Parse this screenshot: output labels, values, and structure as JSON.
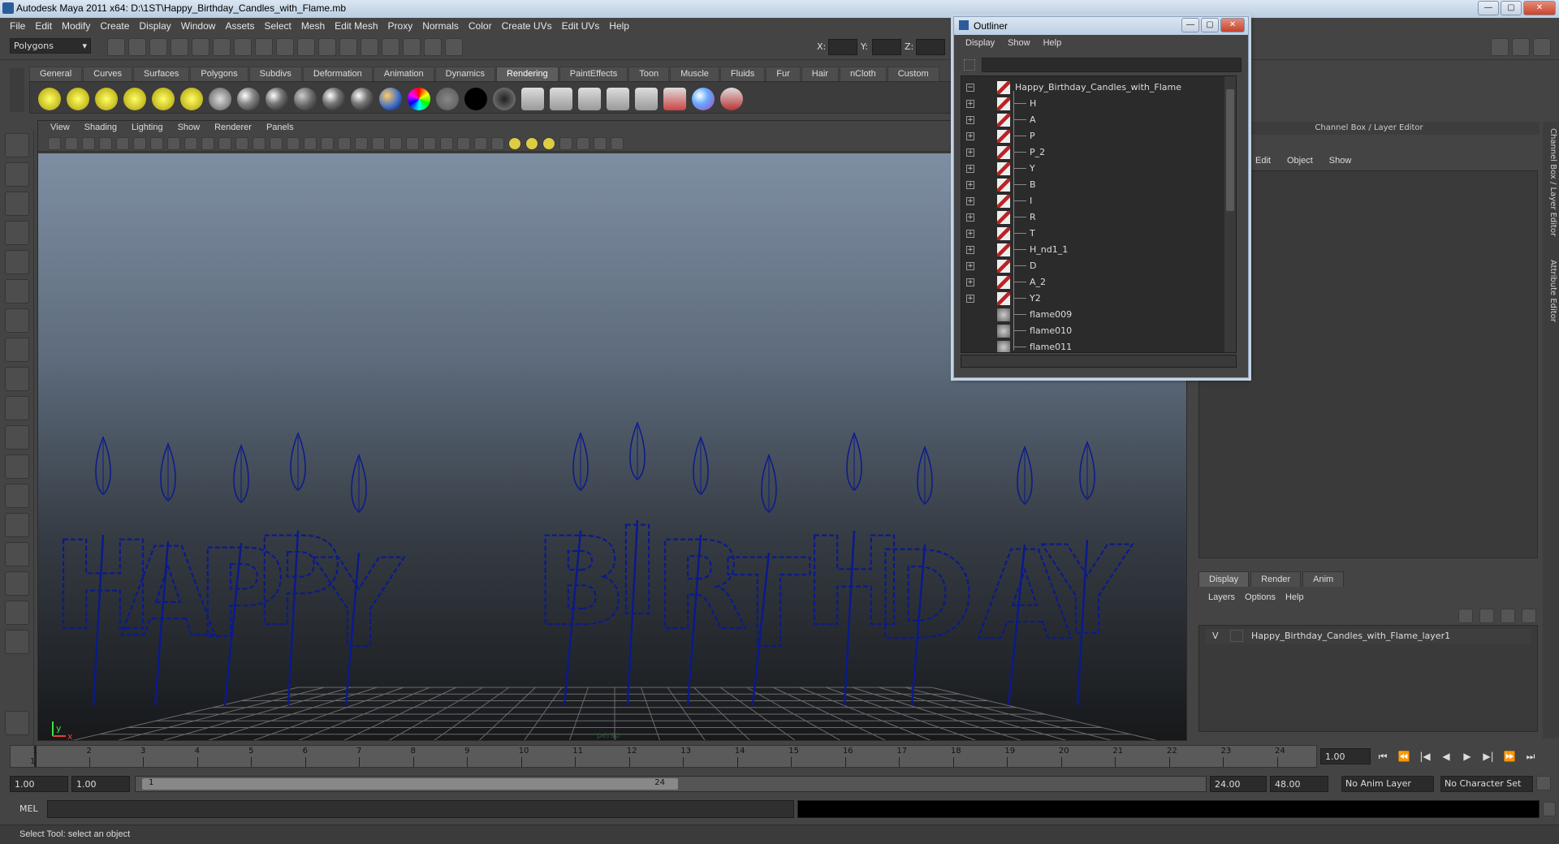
{
  "window": {
    "title": "Autodesk Maya 2011 x64: D:\\1ST\\Happy_Birthday_Candles_with_Flame.mb",
    "minimize": "—",
    "maximize": "▢",
    "close": "✕"
  },
  "menubar": [
    "File",
    "Edit",
    "Modify",
    "Create",
    "Display",
    "Window",
    "Assets",
    "Select",
    "Mesh",
    "Edit Mesh",
    "Proxy",
    "Normals",
    "Color",
    "Create UVs",
    "Edit UVs",
    "Help"
  ],
  "statusline": {
    "mode": "Polygons",
    "x_label": "X:",
    "y_label": "Y:",
    "z_label": "Z:"
  },
  "shelf": {
    "tabs": [
      "General",
      "Curves",
      "Surfaces",
      "Polygons",
      "Subdivs",
      "Deformation",
      "Animation",
      "Dynamics",
      "Rendering",
      "PaintEffects",
      "Toon",
      "Muscle",
      "Fluids",
      "Fur",
      "Hair",
      "nCloth",
      "Custom"
    ],
    "active_tab": "Rendering"
  },
  "viewport": {
    "menu": [
      "View",
      "Shading",
      "Lighting",
      "Show",
      "Renderer",
      "Panels"
    ],
    "axis_y": "y",
    "axis_x": "x",
    "camera_label": "persp",
    "letters": [
      "H",
      "A",
      "P",
      "P",
      "Y",
      "B",
      "I",
      "R",
      "T",
      "H",
      "D",
      "A",
      "Y"
    ],
    "wire_color": "#0a1a8c"
  },
  "timeline": {
    "ticks": [
      "1",
      "2",
      "3",
      "4",
      "5",
      "6",
      "7",
      "8",
      "9",
      "10",
      "11",
      "12",
      "13",
      "14",
      "15",
      "16",
      "17",
      "18",
      "19",
      "20",
      "21",
      "22",
      "23",
      "24"
    ],
    "current_marker": "1",
    "current_frame": "1.00"
  },
  "range": {
    "start": "1.00",
    "playback_start": "1.00",
    "slider_start": "1",
    "slider_end": "24",
    "playback_end": "24.00",
    "end": "48.00",
    "anim_layer": "No Anim Layer",
    "character_set": "No Character Set"
  },
  "command": {
    "label": "MEL"
  },
  "helpline": {
    "text": "Select Tool: select an object"
  },
  "channel_box": {
    "header": "Channel Box / Layer Editor",
    "menu": [
      "Edit",
      "Object",
      "Show"
    ]
  },
  "layer_editor": {
    "tabs": [
      "Display",
      "Render",
      "Anim"
    ],
    "active_tab": "Display",
    "menu": [
      "Layers",
      "Options",
      "Help"
    ],
    "layers": [
      {
        "visible": "V",
        "name": "Happy_Birthday_Candles_with_Flame_layer1"
      }
    ]
  },
  "sidebar": {
    "tabs": [
      "Channel Box / Layer Editor",
      "Attribute Editor"
    ]
  },
  "outliner": {
    "title": "Outliner",
    "menu": [
      "Display",
      "Show",
      "Help"
    ],
    "items": [
      {
        "label": "Happy_Birthday_Candles_with_Flame",
        "expand": "−",
        "type": "mesh",
        "indent": 0
      },
      {
        "label": "H",
        "expand": "+",
        "type": "mesh",
        "indent": 1
      },
      {
        "label": "A",
        "expand": "+",
        "type": "mesh",
        "indent": 1
      },
      {
        "label": "P",
        "expand": "+",
        "type": "mesh",
        "indent": 1
      },
      {
        "label": "P_2",
        "expand": "+",
        "type": "mesh",
        "indent": 1
      },
      {
        "label": "Y",
        "expand": "+",
        "type": "mesh",
        "indent": 1
      },
      {
        "label": "B",
        "expand": "+",
        "type": "mesh",
        "indent": 1
      },
      {
        "label": "I",
        "expand": "+",
        "type": "mesh",
        "indent": 1
      },
      {
        "label": "R",
        "expand": "+",
        "type": "mesh",
        "indent": 1
      },
      {
        "label": "T",
        "expand": "+",
        "type": "mesh",
        "indent": 1
      },
      {
        "label": "H_nd1_1",
        "expand": "+",
        "type": "mesh",
        "indent": 1
      },
      {
        "label": "D",
        "expand": "+",
        "type": "mesh",
        "indent": 1
      },
      {
        "label": "A_2",
        "expand": "+",
        "type": "mesh",
        "indent": 1
      },
      {
        "label": "Y2",
        "expand": "+",
        "type": "mesh",
        "indent": 1
      },
      {
        "label": "flame009",
        "expand": "",
        "type": "flame",
        "indent": 1
      },
      {
        "label": "flame010",
        "expand": "",
        "type": "flame",
        "indent": 1
      },
      {
        "label": "flame011",
        "expand": "",
        "type": "flame",
        "indent": 1
      }
    ]
  }
}
